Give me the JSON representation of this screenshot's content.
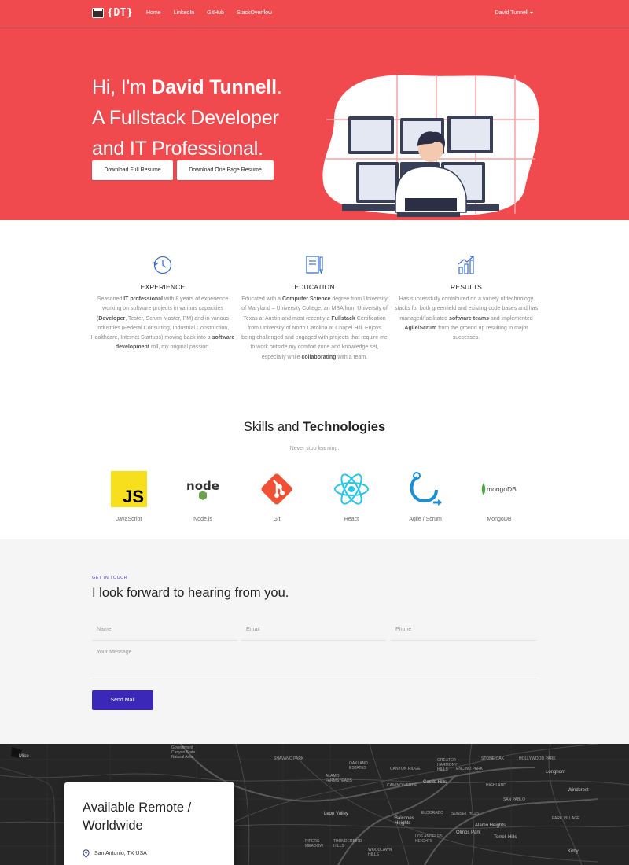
{
  "nav": {
    "brand_text": "{DT}",
    "links": [
      "Home",
      "LinkedIn",
      "GitHub",
      "StackOverflow"
    ],
    "user": "David Tunnell"
  },
  "hero": {
    "line1_prefix": "Hi, I'm ",
    "line1_name": "David Tunnell",
    "line1_suffix": ".",
    "line2": "A Fullstack Developer",
    "line3": "and IT Professional.",
    "btn_full": "Download Full Resume",
    "btn_onepage": "Download One Page Resume"
  },
  "features": [
    {
      "icon": "history-icon",
      "title": "EXPERIENCE",
      "body": [
        {
          "t": "Seasoned "
        },
        {
          "t": "IT professional",
          "b": true
        },
        {
          "t": " with 8 years of experience working on software projects in various capacities ("
        },
        {
          "t": "Developer",
          "b": true
        },
        {
          "t": ", Tester, Scrum Master, PM) and in various industries (Federal Consulting, Industrial Construction, Healthcare, Internet Startups) moving back into a "
        },
        {
          "t": "software development",
          "b": true
        },
        {
          "t": " roll, my original passion."
        }
      ]
    },
    {
      "icon": "notebook-pencil-icon",
      "title": "EDUCATION",
      "body": [
        {
          "t": "Educated with a "
        },
        {
          "t": "Computer Science",
          "b": true
        },
        {
          "t": " degree from University of Maryland – University College, an MBA from University of Texas at Austin and most recently a "
        },
        {
          "t": "Fullstack",
          "b": true
        },
        {
          "t": " Certification from University of North Carolina at Chapel Hill. Enjoys being challenged and engaged with projects that require me to work outside my comfort zone and knowledge set, especially while "
        },
        {
          "t": "collaborating",
          "b": true
        },
        {
          "t": " with a team."
        }
      ]
    },
    {
      "icon": "bar-chart-growth-icon",
      "title": "RESULTS",
      "body": [
        {
          "t": "Has successfully contributed on a variety of technology stacks for both greenfield and existing code bases and has managed/facilitated "
        },
        {
          "t": "software teams",
          "b": true
        },
        {
          "t": " and implemented "
        },
        {
          "t": "Agile/Scrum",
          "b": true
        },
        {
          "t": " from the ground up resulting in major successes."
        }
      ]
    }
  ],
  "skills": {
    "title_prefix": "Skills and ",
    "title_bold": "Technologies",
    "subtitle": "Never stop learning.",
    "items": [
      {
        "label": "JavaScript",
        "icon": "javascript-logo-icon"
      },
      {
        "label": "Node.js",
        "icon": "nodejs-logo-icon"
      },
      {
        "label": "Git",
        "icon": "git-logo-icon"
      },
      {
        "label": "React",
        "icon": "react-logo-icon"
      },
      {
        "label": "Agile / Scrum",
        "icon": "agile-cycle-icon"
      },
      {
        "label": "MongoDB",
        "icon": "mongodb-logo-icon"
      }
    ]
  },
  "logos": {
    "js": "JS",
    "node": "node",
    "mongo": "mongoDB"
  },
  "contact": {
    "kicker": "GET IN TOUCH",
    "title": "I look forward to hearing from you.",
    "name_placeholder": "Name",
    "email_placeholder": "Email",
    "phone_placeholder": "Phone",
    "message_placeholder": "Your Message",
    "send_label": "Send Mail"
  },
  "map": {
    "labels": [
      "Mico",
      "Government Canyon State Natural Area",
      "SHAVANO PARK",
      "OAKLAND ESTATES",
      "ALAMO FARMSTEADS",
      "CANYON RIDGE",
      "ENCINO PARK",
      "STONE OAK",
      "HOLLYWOOD PARK",
      "GREATER HARMONY HILLS",
      "CAMINO VERDE",
      "Castle Hills",
      "HIGHLAND",
      "Longhorn",
      "Windcrest",
      "Leon Valley",
      "ELDORADO",
      "Balcones Heights",
      "Alamo Heights",
      "Olmos Park",
      "Terrell Hills",
      "PIPERS MEADOW",
      "THUNDERBIRD HILLS",
      "LOS ANGELES HEIGHTS",
      "WOODLAWN HILLS",
      "Kirby",
      "SUNSET HILLS",
      "SAN PABLO",
      "PARK VILLAGE"
    ],
    "card_title": "Available Remote / Worldwide",
    "location": "San Antonio, TX USA"
  },
  "colors": {
    "hero_red": "#f04a4f",
    "primary_purple": "#3b28b8",
    "icon_blue": "#3d6fd1"
  }
}
